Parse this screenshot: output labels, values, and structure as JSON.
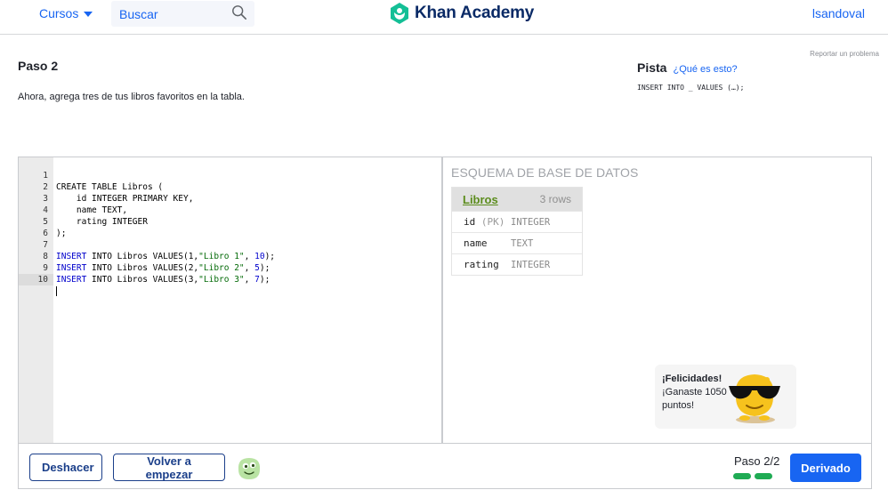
{
  "header": {
    "courses_label": "Cursos",
    "search_placeholder": "Buscar",
    "logo_text": "Khan Academy",
    "username": "lsandoval"
  },
  "step": {
    "report_label": "Reportar un problema",
    "title": "Paso 2",
    "description": "Ahora, agrega tres de tus libros favoritos en la tabla."
  },
  "hint": {
    "title": "Pista",
    "what_label": "¿Qué es esto?",
    "code": "INSERT INTO _ VALUES (…);"
  },
  "editor": {
    "line_numbers": [
      "1",
      "2",
      "3",
      "4",
      "5",
      "6",
      "7",
      "8",
      "9",
      "10"
    ],
    "lines": [
      "CREATE TABLE Libros (",
      "    id INTEGER PRIMARY KEY,",
      "    name TEXT,",
      "    rating INTEGER",
      ");",
      "",
      "INSERT INTO Libros VALUES(1,\"Libro 1\", 10);",
      "INSERT INTO Libros VALUES(2,\"Libro 2\", 5);",
      "INSERT INTO Libros VALUES(3,\"Libro 3\", 7);",
      ""
    ],
    "active_line": 10
  },
  "schema": {
    "title": "ESQUEMA DE BASE DE DATOS",
    "table_name": "Libros",
    "row_count": "3 rows",
    "columns": [
      {
        "name": "id",
        "pk": "(PK)",
        "type": "INTEGER"
      },
      {
        "name": "name",
        "pk": "",
        "type": "TEXT"
      },
      {
        "name": "rating",
        "pk": "",
        "type": "INTEGER"
      }
    ]
  },
  "toast": {
    "title": "¡Felicidades!",
    "line1": "¡Ganaste 1050",
    "line2": "puntos!"
  },
  "footer": {
    "undo_label": "Deshacer",
    "restart_label": "Volver a empezar",
    "step_count": "Paso 2/2",
    "progress_completed": 2,
    "progress_total": 2,
    "next_label": "Derivado"
  },
  "colors": {
    "accent": "#1865f2",
    "progress": "#1fab54",
    "schema_link": "#5b8c1c"
  }
}
